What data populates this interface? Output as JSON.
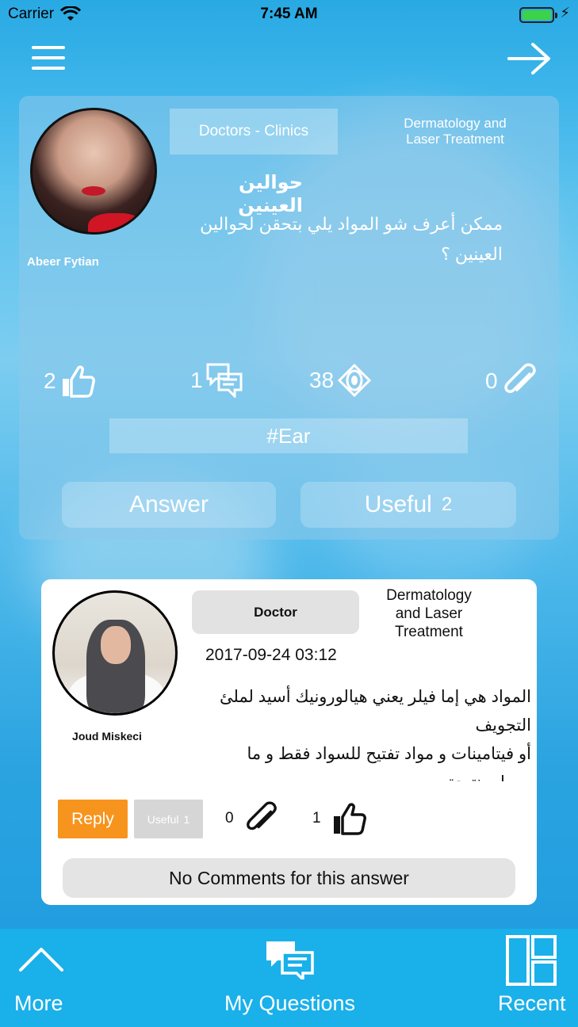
{
  "status_bar": {
    "carrier": "Carrier",
    "time": "7:45 AM"
  },
  "question": {
    "author": "Abeer Fytian",
    "category": "Doctors - Clinics",
    "speciality": "Dermatology and Laser Treatment",
    "title": "حوالين العينين",
    "body": "ممكن أعرف شو المواد يلي بتحقن لحوالين العينين ؟",
    "likes": "2",
    "comments": "1",
    "views": "38",
    "attachments": "0",
    "tag": "#Ear",
    "answer_label": "Answer",
    "useful_label": "Useful",
    "useful_count": "2"
  },
  "answer": {
    "author": "Joud Miskeci",
    "role": "Doctor",
    "speciality": "Dermatology and Laser Treatment",
    "date": "2017-09-24 03:12",
    "body": "المواد هي إما فيلر يعني هيالورونيك أسيد لملئ التجويف\nأو فيتامينات و مواد تفتيح للسواد فقط و ما بيعطي نتيجة",
    "reply_label": "Reply",
    "useful_label": "Useful",
    "useful_count": "1",
    "attachments": "0",
    "likes": "1",
    "comments_status": "No Comments for this answer"
  },
  "tab_bar": {
    "more": "More",
    "my_questions": "My Questions",
    "recent": "Recent"
  },
  "colors": {
    "accent_orange": "#f7941d",
    "tab_bar": "#1ab0ea",
    "battery": "#3cd24a"
  },
  "icons": [
    "menu-icon",
    "forward-arrow-icon",
    "thumbs-up-icon",
    "chat-bubbles-icon",
    "eye-icon",
    "paperclip-icon",
    "chevron-up-icon",
    "layout-grid-icon",
    "wifi-icon",
    "battery-icon"
  ]
}
